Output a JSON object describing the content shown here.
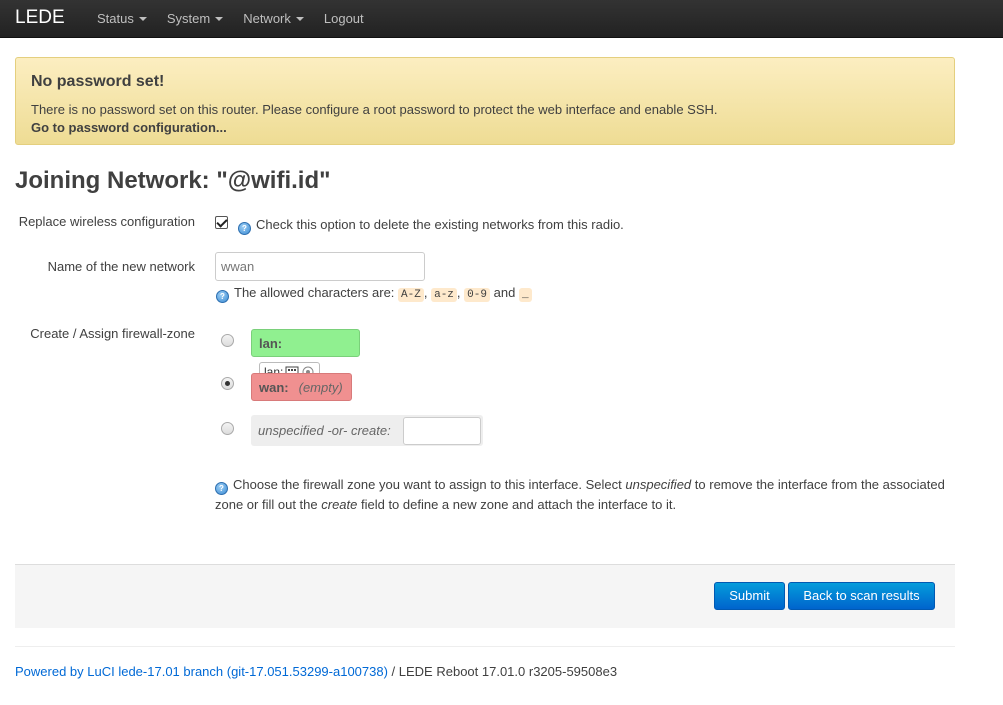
{
  "navbar": {
    "brand": "LEDE",
    "menu": [
      {
        "label": "Status",
        "dropdown": true
      },
      {
        "label": "System",
        "dropdown": true
      },
      {
        "label": "Network",
        "dropdown": true
      },
      {
        "label": "Logout",
        "dropdown": false
      }
    ]
  },
  "alert": {
    "title": "No password set!",
    "message": "There is no password set on this router. Please configure a root password to protect the web interface and enable SSH.",
    "link": "Go to password configuration..."
  },
  "page": {
    "title": "Joining Network: \"@wifi.id\""
  },
  "form": {
    "replace": {
      "label": "Replace wireless configuration",
      "checked": true,
      "help": "Check this option to delete the existing networks from this radio."
    },
    "name": {
      "label": "Name of the new network",
      "value": "wwan",
      "help_prefix": "The allowed characters are:",
      "chars": [
        "A-Z",
        "a-z",
        "0-9",
        "_"
      ],
      "sep1": ",",
      "sep2": ",",
      "and": "and"
    },
    "zone": {
      "label": "Create / Assign firewall-zone",
      "options": [
        {
          "name": "lan:",
          "detail": "lan:",
          "selected": false,
          "color": "#90f090"
        },
        {
          "name": "wan:",
          "detail": "(empty)",
          "selected": true,
          "color": "#f09090"
        },
        {
          "name": "unspecified -or- create:",
          "selected": false
        }
      ],
      "help_line1_a": "Choose the firewall zone you want to assign to this interface. Select ",
      "help_line1_em": "unspecified",
      "help_line1_b": " to remove the interface from the associated",
      "help_line2_a": "zone or fill out the ",
      "help_line2_em": "create",
      "help_line2_b": " field to define a new zone and attach the interface to it."
    }
  },
  "buttons": {
    "submit": "Submit",
    "back": "Back to scan results"
  },
  "footer": {
    "link": "Powered by LuCI lede-17.01 branch (git-17.051.53299-a100738)",
    "text": " / LEDE Reboot 17.01.0 r3205-59508e3"
  },
  "colors": {
    "navbar": "#222222",
    "alert_bg": "#fceec1",
    "primary_button": "#0064cd",
    "lan_zone": "#90f090",
    "wan_zone": "#f09090"
  }
}
